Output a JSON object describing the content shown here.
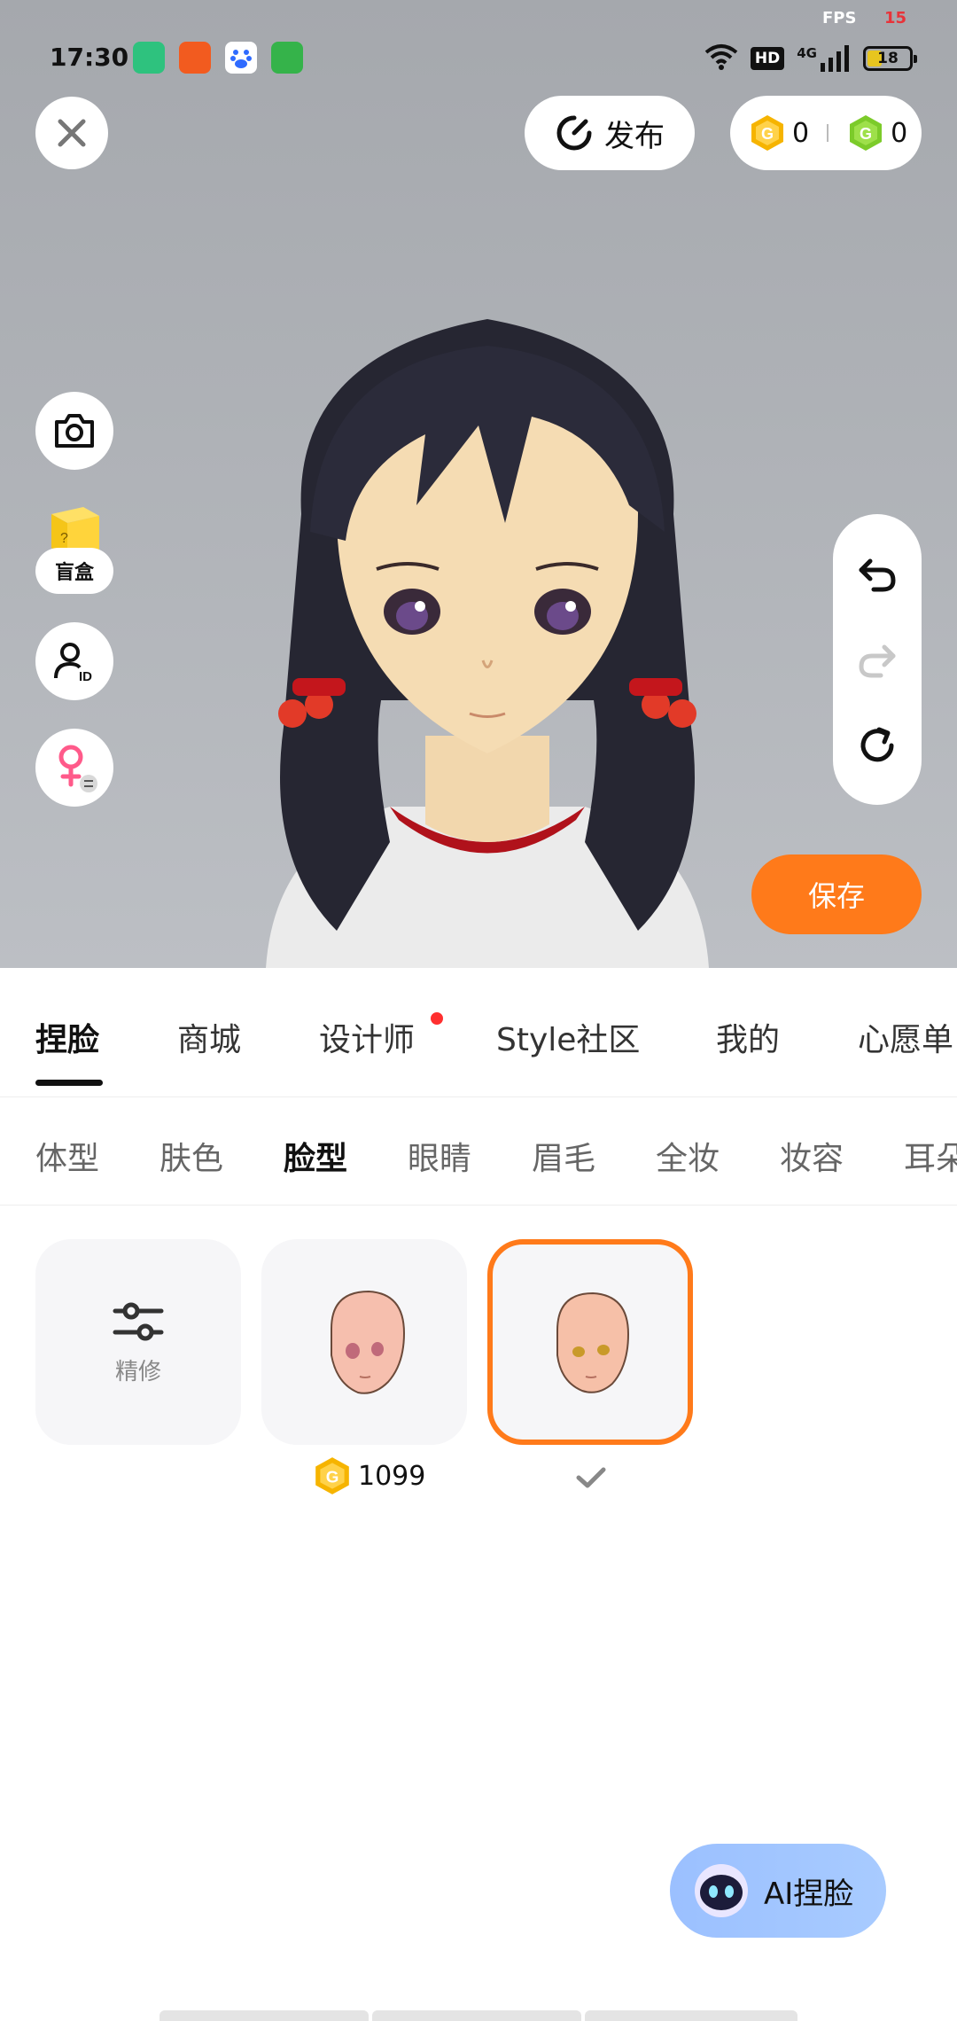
{
  "status_bar": {
    "time": "17:30",
    "fps_label": "FPS",
    "fps_value": "15",
    "network": "4G",
    "hd": "HD",
    "battery": "18"
  },
  "header": {
    "publish_label": "发布",
    "coin_gold": "0",
    "coin_green": "0"
  },
  "side": {
    "blindbox_label": "盲盒"
  },
  "save_label": "保存",
  "main_tabs": [
    {
      "label": "捏脸"
    },
    {
      "label": "商城"
    },
    {
      "label": "设计师"
    },
    {
      "label": "Style社区"
    },
    {
      "label": "我的"
    },
    {
      "label": "心愿单"
    }
  ],
  "sub_tabs": [
    {
      "label": "体型"
    },
    {
      "label": "肤色"
    },
    {
      "label": "脸型"
    },
    {
      "label": "眼睛"
    },
    {
      "label": "眉毛"
    },
    {
      "label": "全妆"
    },
    {
      "label": "妆容"
    },
    {
      "label": "耳朵"
    }
  ],
  "items": {
    "refine_label": "精修",
    "price": "1099"
  },
  "ai_button_label": "AI捏脸",
  "colors": {
    "accent": "#ff7a1a",
    "gold_coin": "#f6b400",
    "green_coin": "#7ccb2a",
    "red_dot": "#ff2f2f"
  }
}
